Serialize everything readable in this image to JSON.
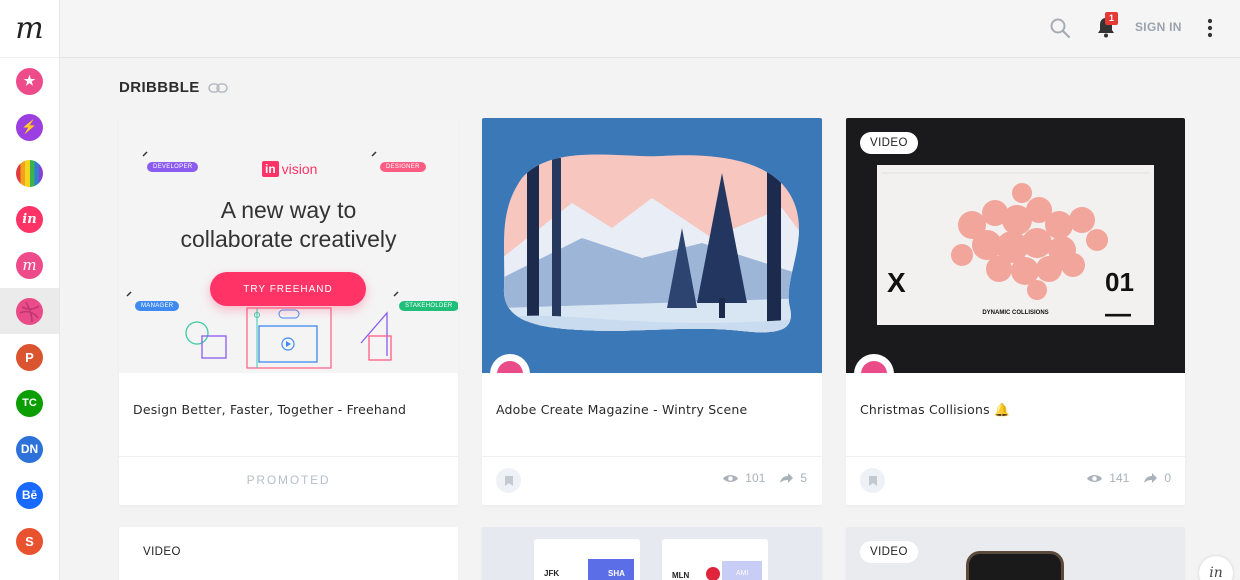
{
  "app": {
    "logo_letter": "m"
  },
  "sidebar": {
    "sources": [
      {
        "name": "favorites",
        "icon": "star-icon",
        "color": "#ee4b8b",
        "glyph": "★"
      },
      {
        "name": "trending",
        "icon": "bolt-icon",
        "color": "#9c3fe0",
        "glyph": "⚡"
      },
      {
        "name": "colors",
        "icon": "rainbow-icon",
        "color": "#e0a52b",
        "glyph": ""
      },
      {
        "name": "invision",
        "icon": "invision-icon",
        "color": "#ff3366",
        "glyph": "in"
      },
      {
        "name": "muzli",
        "icon": "muzli-icon",
        "color": "#ee4b8b",
        "glyph": "m"
      },
      {
        "name": "dribbble",
        "icon": "dribbble-icon",
        "color": "#ea4c89",
        "glyph": ""
      },
      {
        "name": "product-hunt",
        "icon": "product-hunt-icon",
        "color": "#da552f",
        "glyph": "P"
      },
      {
        "name": "techcrunch",
        "icon": "techcrunch-icon",
        "color": "#0a9e01",
        "glyph": "TC"
      },
      {
        "name": "designer-news",
        "icon": "designer-news-icon",
        "color": "#2d72d9",
        "glyph": "DN"
      },
      {
        "name": "behance",
        "icon": "behance-icon",
        "color": "#1769ff",
        "glyph": "Bē"
      },
      {
        "name": "smashing",
        "icon": "smashing-icon",
        "color": "#e8522f",
        "glyph": "S"
      }
    ]
  },
  "topbar": {
    "notification_count": "1",
    "signin_label": "SIGN IN"
  },
  "section": {
    "title": "DRIBBBLE"
  },
  "cards": [
    {
      "type": "promo",
      "title": "Design Better, Faster, Together - Freehand",
      "footer_label": "PROMOTED",
      "promo": {
        "logo_badge": "in",
        "logo_text": "vision",
        "headline_line1": "A new way to",
        "headline_line2": "collaborate creatively",
        "cta_label": "TRY FREEHAND",
        "tags": [
          "DEVELOPER",
          "DESIGNER",
          "MANAGER",
          "STAKEHOLDER"
        ]
      }
    },
    {
      "type": "shot",
      "title": "Adobe Create Magazine - Wintry Scene",
      "views": "101",
      "shares": "5",
      "colors": [
        "#3a78b5",
        "#d6e4f0",
        "#0f2447",
        "#1b3566",
        "#7fb8e6"
      ]
    },
    {
      "type": "shot",
      "video_label": "VIDEO",
      "title": "Christmas Collisions 🔔",
      "views": "141",
      "shares": "0",
      "colors": [
        "#161616",
        "#f2e4e4",
        "#e05a4c",
        "#f0806c",
        "#6d6d6d"
      ],
      "media": {
        "left_text": "X",
        "right_text": "01—",
        "caption": "DYNAMIC COLLISIONS"
      }
    }
  ],
  "row2": [
    {
      "video_label": "VIDEO"
    },
    {
      "mini_labels": [
        "JFK",
        "SHA",
        "MLN",
        "AMI"
      ]
    },
    {
      "video_label": "VIDEO"
    }
  ],
  "helper": {
    "label": "in"
  }
}
